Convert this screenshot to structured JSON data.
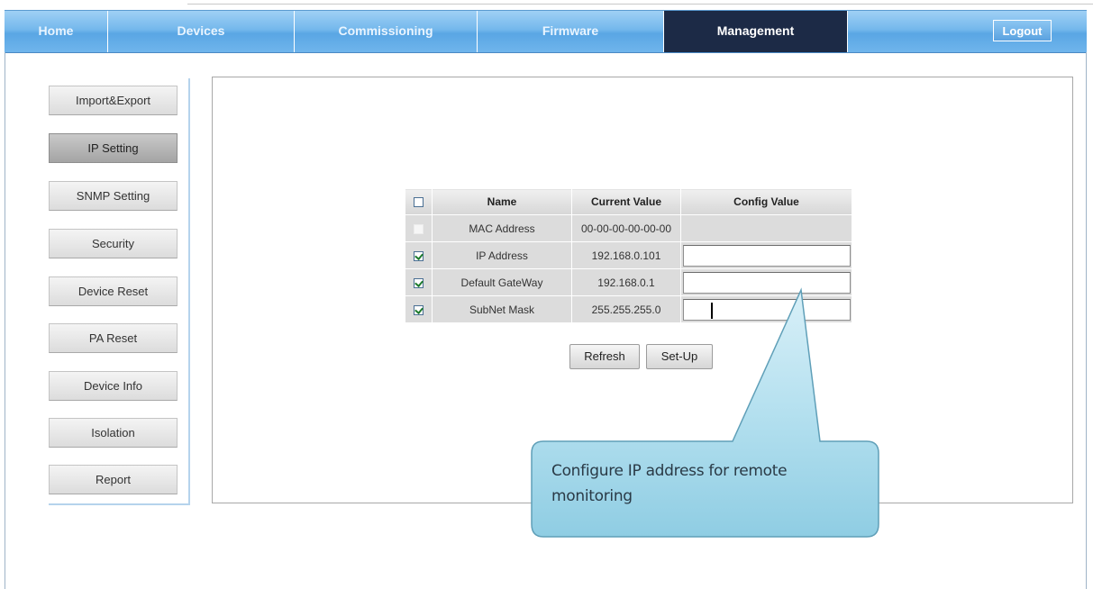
{
  "nav": {
    "tabs": [
      {
        "label": "Home"
      },
      {
        "label": "Devices"
      },
      {
        "label": "Commissioning"
      },
      {
        "label": "Firmware"
      },
      {
        "label": "Management",
        "active": true
      }
    ],
    "logout_label": "Logout"
  },
  "sidebar": {
    "items": [
      {
        "label": "Import&Export"
      },
      {
        "label": "IP Setting",
        "active": true
      },
      {
        "label": "SNMP Setting"
      },
      {
        "label": "Security"
      },
      {
        "label": "Device Reset"
      },
      {
        "label": "PA Reset"
      },
      {
        "label": "Device Info"
      },
      {
        "label": "Isolation"
      },
      {
        "label": "Report"
      }
    ]
  },
  "table": {
    "headers": {
      "name": "Name",
      "current": "Current Value",
      "config": "Config Value"
    },
    "rows": [
      {
        "name": "MAC Address",
        "current": "00-00-00-00-00-00",
        "checked": false,
        "config": ""
      },
      {
        "name": "IP Address",
        "current": "192.168.0.101",
        "checked": true,
        "config": ""
      },
      {
        "name": "Default GateWay",
        "current": "192.168.0.1",
        "checked": true,
        "config": ""
      },
      {
        "name": "SubNet Mask",
        "current": "255.255.255.0",
        "checked": true,
        "config": ""
      }
    ]
  },
  "actions": {
    "refresh_label": "Refresh",
    "setup_label": "Set-Up"
  },
  "callout": {
    "text": "Configure IP address for remote monitoring"
  },
  "colors": {
    "nav_active": "#1c2a46",
    "nav_bar": "#74b8ec",
    "callout_fill": "#a9d9ea"
  }
}
